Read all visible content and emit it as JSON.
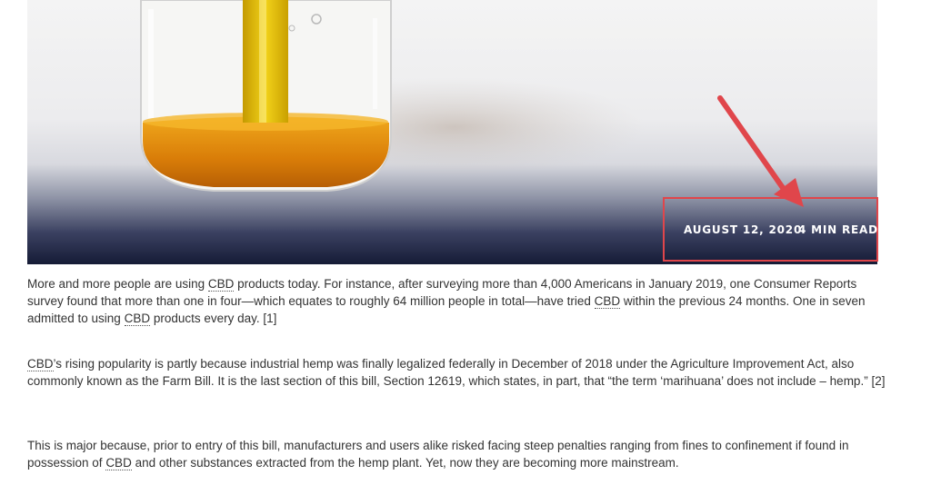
{
  "hero": {
    "meta_date": "AUGUST 12, 2020",
    "meta_read_time": "4 MIN READ",
    "highlight_color": "#e0464b"
  },
  "article": {
    "paragraphs": [
      {
        "parts": [
          "More and more people are using ",
          "CBD",
          " products today. For instance, after surveying more than 4,000 Americans in January 2019, one Consumer Reports survey found that more than one in four—which equates to roughly 64 million people in total—have tried ",
          "CBD",
          " within the previous 24 months. One in seven admitted to using ",
          "CBD",
          " products every day. [1]"
        ]
      },
      {
        "parts": [
          "CBD",
          "’s rising popularity is partly because industrial hemp was finally legalized federally in December of 2018 under the Agriculture Improvement Act, also commonly known as the Farm Bill. It is the last section of this bill, Section 12619, which states, in part, that “the term ‘marihuana’ does not include – hemp.” [2]"
        ]
      },
      {
        "parts": [
          "This is major because, prior to entry of this bill, manufacturers and users alike risked facing steep penalties ranging from fines to confinement if found in possession of ",
          "CBD",
          " and other substances extracted from the hemp plant. Yet, now they are becoming more mainstream."
        ]
      }
    ]
  }
}
